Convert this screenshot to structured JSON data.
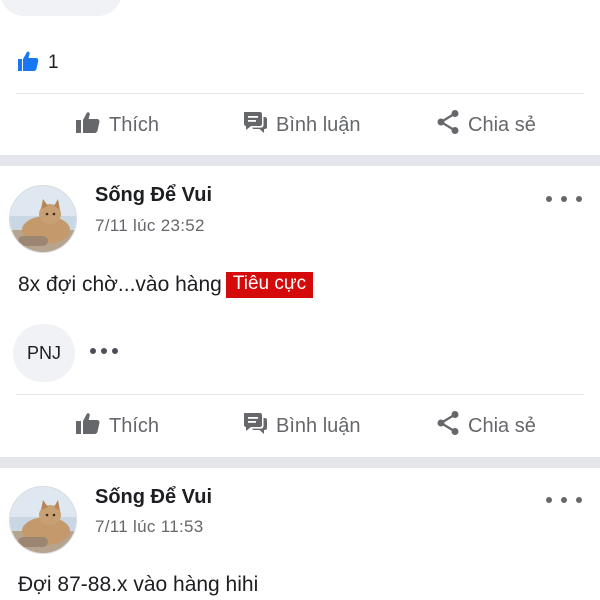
{
  "previous_post": {
    "reaction_count": "1"
  },
  "actions": {
    "like": "Thích",
    "comment": "Bình luận",
    "share": "Chia sẻ"
  },
  "posts": [
    {
      "author": "Sống Để Vui",
      "time": "7/11 lúc 23:52",
      "text": "8x đợi chờ...vào hàng",
      "badge": "Tiêu cực",
      "tag": "PNJ"
    },
    {
      "author": "Sống Để Vui",
      "time": "7/11 lúc 11:53",
      "text": "Đợi 87-88.x vào hàng hihi"
    }
  ],
  "colors": {
    "badge_negative": "#d50a0a",
    "like_accent": "#1877f2",
    "action_gray": "#65676b",
    "separator": "#e4e6eb"
  },
  "icons": [
    "thumbs-up-icon",
    "comment-icon",
    "share-icon",
    "more-dots-icon",
    "avatar-cat"
  ]
}
